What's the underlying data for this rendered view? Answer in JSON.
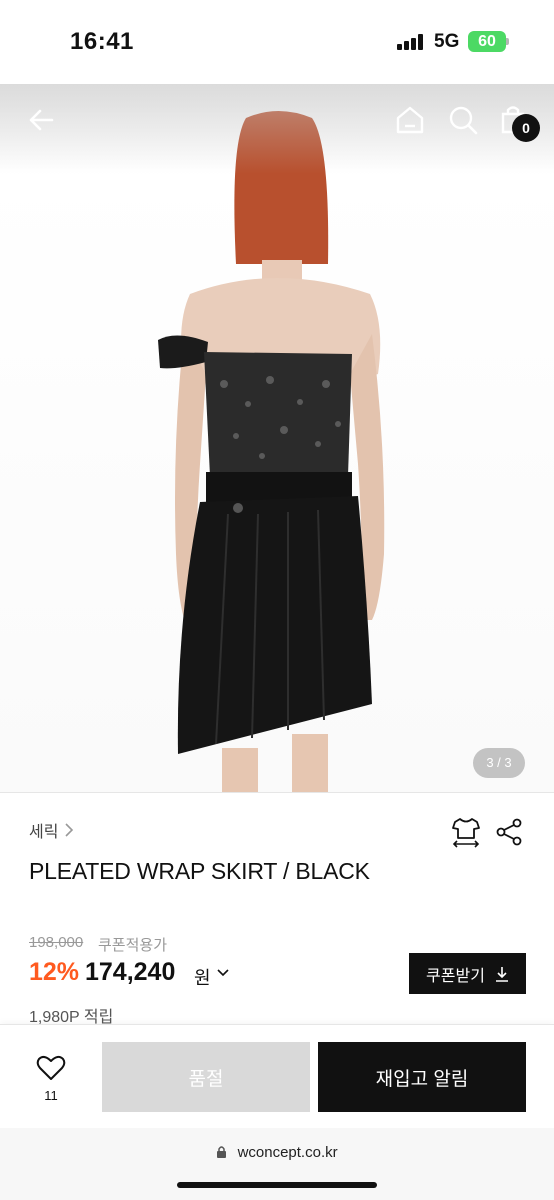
{
  "status_bar": {
    "time": "16:41",
    "network": "5G",
    "battery": "60"
  },
  "gallery": {
    "cart_count": "0",
    "page_indicator": "3 / 3",
    "icons": [
      "back-arrow-icon",
      "home-icon",
      "search-icon",
      "shopping-bag-icon"
    ]
  },
  "product": {
    "brand": "세릭",
    "name": "PLEATED WRAP SKIRT / BLACK",
    "original_price": "198,000",
    "coupon_note": "쿠폰적용가",
    "discount": "12%",
    "price": "174,240",
    "currency": "원",
    "coupon_button": "쿠폰받기",
    "points": "1,980P 적립"
  },
  "actions": {
    "wish_count": "11",
    "soldout_label": "품절",
    "restock_label": "재입고 알림"
  },
  "browser": {
    "url": "wconcept.co.kr"
  },
  "colors": {
    "accent_discount": "#ff5a1f",
    "primary_button": "#111111",
    "disabled_button": "#d9d9d9",
    "battery": "#4cd964"
  }
}
